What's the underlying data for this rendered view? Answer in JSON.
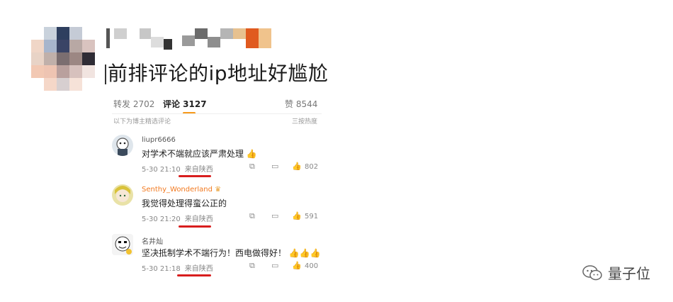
{
  "post": {
    "title": "前排评论的ip地址好尴尬"
  },
  "tabs": [
    {
      "label": "转发 2702"
    },
    {
      "label": "评论 3127"
    },
    {
      "label": "赞 8544"
    }
  ],
  "subbar": {
    "left": "以下为博主精选评论",
    "right": "三按热度"
  },
  "comments": [
    {
      "user": "liupr6666",
      "text": "对学术不端就应该严肃处理",
      "time": "5-30 21:10",
      "location": "来自陕西",
      "likes": "802"
    },
    {
      "user": "Senthy_Wonderland",
      "text": "我觉得处理得蛮公正的",
      "time": "5-30 21:20",
      "location": "来自陕西",
      "likes": "591"
    },
    {
      "user": "名井灿",
      "text": "坚决抵制学术不端行为！西电做得好！",
      "time": "5-30 21:18",
      "location": "来自陕西",
      "likes": "400"
    }
  ],
  "watermark": {
    "text": "量子位"
  },
  "colors": {
    "accent": "#f79a1b",
    "highlight": "#d81e1e",
    "vip": "#f2791f"
  }
}
